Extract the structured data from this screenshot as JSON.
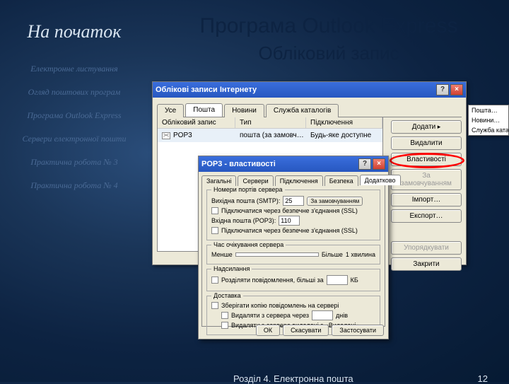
{
  "sidebar": {
    "title": "На початок",
    "items": [
      "Електронне листування",
      "Огляд поштових програм",
      "Програма Outlook Express",
      "Сервери електронної пошти",
      "Практична робота № 3",
      "Практична робота № 4"
    ]
  },
  "main": {
    "title": "Програма Outlook Express",
    "subtitle": "Обліковий запис"
  },
  "dlg1": {
    "title": "Облікові записи Інтернету",
    "tabs": [
      "Усе",
      "Пошта",
      "Новини",
      "Служба каталогів"
    ],
    "active_tab": 1,
    "cols": [
      "Обліковий запис",
      "Тип",
      "Підключення"
    ],
    "row": {
      "name": "POP3",
      "type": "пошта (за замовч…",
      "conn": "Будь-яке доступне"
    },
    "buttons": {
      "add": "Додати",
      "remove": "Видалити",
      "props": "Властивості",
      "default": "За замовчуванням",
      "import": "Імпорт…",
      "export": "Експорт…",
      "order": "Упорядкувати",
      "close": "Закрити"
    }
  },
  "dropdown": {
    "items": [
      "Пошта…",
      "Новини…",
      "Служба каталогів…"
    ]
  },
  "dlg2": {
    "title": "POP3 - властивості",
    "tabs": [
      "Загальні",
      "Сервери",
      "Підключення",
      "Безпека",
      "Додатково"
    ],
    "active_tab": 4,
    "group1": {
      "title": "Номери портів сервера",
      "out_label": "Вихідна пошта (SMTP):",
      "out_value": "25",
      "reset": "За замовчуванням",
      "out_ssl": "Підключатися через безпечне з'єднання (SSL)",
      "in_label": "Вхідна пошта (POP3):",
      "in_value": "110",
      "in_ssl": "Підключатися через безпечне з'єднання (SSL)"
    },
    "group2": {
      "title": "Час очікування сервера",
      "short": "Менше",
      "long": "Більше",
      "val": "1 хвилина"
    },
    "group3": {
      "title": "Надсилання",
      "split": "Розділяти повідомлення, більші за",
      "kb": "КБ"
    },
    "group4": {
      "title": "Доставка",
      "leave": "Зберігати копію повідомлень на сервері",
      "remove_after": "Видаляти з сервера через",
      "days": "днів",
      "remove_del": "Видаляти з сервера видалені з «Видалені»"
    },
    "buttons": {
      "ok": "ОК",
      "cancel": "Скасувати",
      "apply": "Застосувати"
    }
  },
  "footer": {
    "text": "Розділ 4. Електронна пошта",
    "page": "12"
  }
}
